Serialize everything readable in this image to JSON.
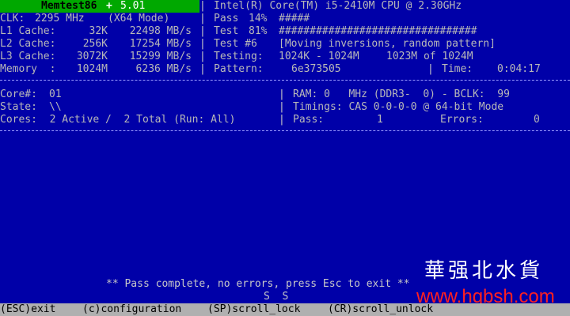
{
  "header": {
    "app_name": "Memtest86",
    "plus": "+",
    "version": "5.01"
  },
  "cpu": {
    "name": "Intel(R) Core(TM) i5-2410M CPU @ 2.30GHz",
    "clk_label": "CLK:",
    "clk_value": "2295 MHz",
    "mode": "(X64 Mode)",
    "pass_label": "Pass",
    "pass_pct": "14%",
    "pass_bar": "#####",
    "test_label": "Test",
    "test_pct": "81%",
    "test_bar": "################################",
    "test_num_label": "Test #6",
    "test_desc": "[Moving inversions, random pattern]",
    "testing_label": "Testing:",
    "testing_range": "1024K - 1024M",
    "testing_of": "1023M of 1024M",
    "pattern_label": "Pattern:",
    "pattern_value": "6e373505",
    "time_label": "Time:",
    "time_value": "0:04:17"
  },
  "caches": [
    {
      "label": "L1 Cache:",
      "size": "32K",
      "speed": "22498 MB/s"
    },
    {
      "label": "L2 Cache:",
      "size": "256K",
      "speed": "17254 MB/s"
    },
    {
      "label": "L3 Cache:",
      "size": "3072K",
      "speed": "15299 MB/s"
    },
    {
      "label": "Memory  :",
      "size": "1024M",
      "speed": "6236 MB/s"
    }
  ],
  "status": {
    "core_label": "Core#:",
    "core_value": "01",
    "state_label": "State:",
    "state_value": "\\\\",
    "cores_text": "Cores:  2 Active /  2 Total (Run: All)",
    "ram_text": "RAM: 0   MHz (DDR3-  0) - BCLK:  99",
    "timings_text": "Timings: CAS 0-0-0-0 @ 64-bit Mode",
    "pass_label": "Pass:",
    "pass_value": "1",
    "errors_label": "Errors:",
    "errors_value": "0"
  },
  "message": "** Pass complete, no errors, press Esc to exit **",
  "scroll_indicator": "S  S",
  "footer": {
    "esc": "(ESC)exit",
    "config": "(c)configuration",
    "scroll_lock": "(SP)scroll_lock",
    "scroll_unlock": "(CR)scroll_unlock"
  },
  "watermark": {
    "chinese": "華强北水貨",
    "url": "www.hqbsh.com"
  },
  "colors": {
    "background": "#0000a8",
    "title_bar": "#00a800",
    "footer_bar": "#b0b0b0",
    "watermark_url": "#ff2020"
  }
}
